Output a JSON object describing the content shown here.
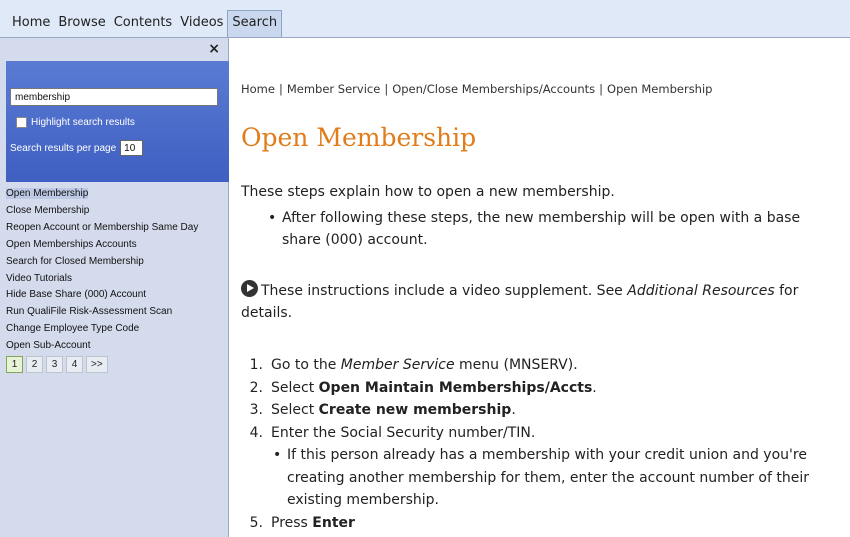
{
  "topnav": {
    "tabs": [
      {
        "label": "Home"
      },
      {
        "label": "Browse"
      },
      {
        "label": "Contents"
      },
      {
        "label": "Videos"
      },
      {
        "label": "Search",
        "active": true
      }
    ]
  },
  "sidebar": {
    "close_glyph": "×",
    "search": {
      "value": "membership",
      "highlight_label": "Highlight search results",
      "per_page_label": "Search results per page",
      "per_page_value": "10"
    },
    "results": [
      "Open Membership",
      "Close Membership",
      "Reopen Account or Membership Same Day",
      "Open Memberships Accounts",
      "Search for Closed Membership",
      "Video Tutorials",
      "Hide Base Share (000) Account",
      "Run QualiFile Risk-Assessment Scan",
      "Change Employee Type Code",
      "Open Sub-Account"
    ],
    "pager": [
      "1",
      "2",
      "3",
      "4",
      ">>"
    ]
  },
  "main": {
    "breadcrumb": [
      "Home",
      "Member Service",
      "Open/Close Memberships/Accounts",
      "Open Membership"
    ],
    "breadcrumb_sep": "|",
    "title": "Open Membership",
    "intro": "These steps explain how to open a new membership.",
    "bullet": "After following these steps, the new membership will be open with a base share (000) account.",
    "video_note": {
      "pre": "These instructions include a video supplement. See ",
      "em": "Additional Resources",
      "post": " for details."
    },
    "steps": {
      "s1": {
        "num": "1.",
        "pre": "Go to the ",
        "em": "Member Service",
        "post": " menu (MNSERV)."
      },
      "s2": {
        "num": "2.",
        "pre": "Select ",
        "strong": "Open Maintain Memberships/Accts",
        "post": "."
      },
      "s3": {
        "num": "3.",
        "pre": "Select ",
        "strong": "Create new membership",
        "post": "."
      },
      "s4": {
        "num": "4.",
        "text": "Enter the Social Security number/TIN."
      },
      "s4_sub": "If this person already has a membership with your credit union and you're creating another membership for them, enter the account number of their existing membership.",
      "s5": {
        "num": "5.",
        "pre": "Press ",
        "strong": "Enter",
        "post": ""
      }
    }
  }
}
